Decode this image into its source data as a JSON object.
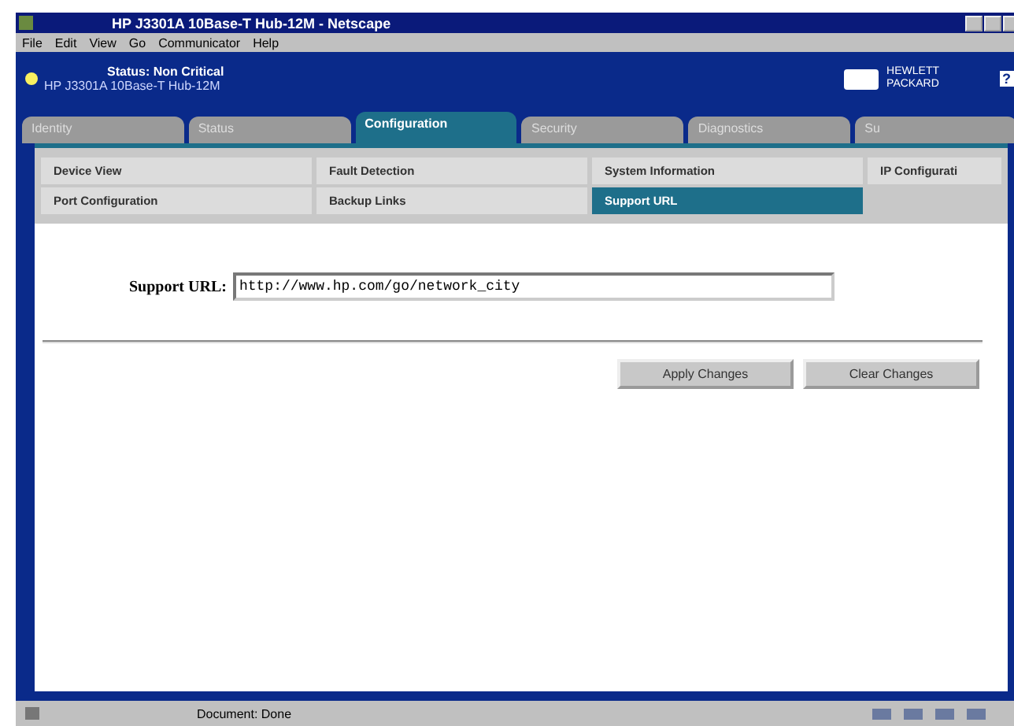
{
  "window": {
    "title": "HP J3301A 10Base-T Hub-12M - Netscape"
  },
  "menu": [
    "File",
    "Edit",
    "View",
    "Go",
    "Communicator",
    "Help"
  ],
  "header": {
    "status": "Status: Non Critical",
    "device": "HP J3301A 10Base-T Hub-12M",
    "logo_line_1": "HEWLETT",
    "logo_line_2": "PACKARD",
    "help": "?"
  },
  "tabs": [
    {
      "label": "Identity",
      "selected": false
    },
    {
      "label": "Status",
      "selected": false
    },
    {
      "label": "Configuration",
      "selected": true
    },
    {
      "label": "Security",
      "selected": false
    },
    {
      "label": "Diagnostics",
      "selected": false
    },
    {
      "label": "Su",
      "selected": false
    }
  ],
  "subtabs": [
    {
      "label": "Device View",
      "selected": false
    },
    {
      "label": "Fault Detection",
      "selected": false
    },
    {
      "label": "System Information",
      "selected": false
    },
    {
      "label": "IP Configurati",
      "selected": false
    },
    {
      "label": "Port Configuration",
      "selected": false
    },
    {
      "label": "Backup Links",
      "selected": false
    },
    {
      "label": "Support URL",
      "selected": true
    }
  ],
  "form": {
    "label": "Support URL:",
    "value": "http://www.hp.com/go/network_city"
  },
  "buttons": [
    "Apply Changes",
    "Clear Changes"
  ],
  "status_bar": {
    "text": "Document: Done"
  }
}
